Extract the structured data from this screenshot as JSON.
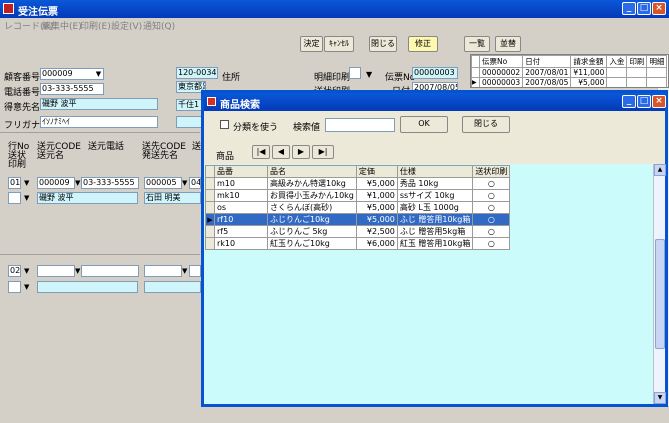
{
  "window": {
    "title": "受注伝票"
  },
  "menu": [
    "レコード(R)",
    "編集中(E)",
    "印刷(E)",
    "設定(V)",
    "通知(Q)"
  ],
  "toolbar": {
    "decide": "決定",
    "cancel": "ｷｬﾝｾﾙ",
    "close": "閉じる",
    "modify": "修正",
    "list": "一覧",
    "export": "並替"
  },
  "customer": {
    "customer_no_label": "顧客番号",
    "customer_no": "000009",
    "phone_label": "電話番号",
    "phone": "03-333-5555",
    "dest_label": "得意先名",
    "dest": "磯野 波平",
    "kana_label": "フリガナ",
    "kana": "ｲｿﾉﾅﾐﾍｲ",
    "zip": "120-0034",
    "address_label": "住所",
    "address1": "東京都足立区",
    "address2": "千住1"
  },
  "slip": {
    "detail_print_label": "明細印刷",
    "ship_print_label": "送状印刷",
    "slip_no_label": "伝票No",
    "slip_no": "00000003",
    "date_label": "日付",
    "date": "2007/08/05"
  },
  "right_grid": {
    "headers": [
      "伝票No",
      "日付",
      "請求金額",
      "入金",
      "印刷",
      "明細"
    ],
    "rows": [
      [
        "00000002",
        "2007/08/01",
        "¥11,000"
      ],
      [
        "00000003",
        "2007/08/05",
        "¥5,000"
      ]
    ]
  },
  "detail": {
    "headers": {
      "line_no": "行No",
      "ship_print": "送状",
      "print": "印刷",
      "from_code": "送元CODE",
      "from_name": "送元名",
      "from_phone": "送元電話",
      "to_code": "送先CODE",
      "to_name": "発送先名",
      "to_short": "送先"
    },
    "row1": {
      "line": "01",
      "from_code": "000009",
      "from_phone": "03-333-5555",
      "to_code": "000005",
      "to_short": "04",
      "from_name": "磯野 波平",
      "to_name": "石田 明美"
    },
    "row2": {
      "line": "02"
    }
  },
  "modal": {
    "title": "商品検索",
    "use_category": "分類を使う",
    "search_value_label": "検索値",
    "search_value": "",
    "ok": "OK",
    "close": "閉じる",
    "product_label": "商品",
    "nav": [
      "|◀",
      "◀",
      "▶",
      "▶|"
    ],
    "columns": [
      "品番",
      "品名",
      "定価",
      "仕様",
      "送状印刷"
    ],
    "rows": [
      [
        "m10",
        "高級みかん特選10kg",
        "¥5,000",
        "秀品 10kg",
        "○"
      ],
      [
        "mk10",
        "お買得小玉みかん10kg",
        "¥1,000",
        "ssサイズ 10kg",
        "○"
      ],
      [
        "os",
        "さくらんぼ(高砂)",
        "¥5,000",
        "高砂 L玉 1000g",
        "○"
      ],
      [
        "rf10",
        "ふじりんご10kg",
        "¥5,000",
        "ふじ 贈答用10kg箱",
        "○"
      ],
      [
        "rf5",
        "ふじりんご 5kg",
        "¥2,500",
        "ふじ 贈答用5kg箱",
        "○"
      ],
      [
        "rk10",
        "紅玉りんご10kg",
        "¥6,000",
        "紅玉 贈答用10kg箱",
        "○"
      ]
    ],
    "selected_row": 3
  },
  "colors": {
    "titlebar": "#0a58d8",
    "selection": "#316ac5",
    "cyan_field": "#cff5fa",
    "modal_panel": "#cbfbfb"
  }
}
